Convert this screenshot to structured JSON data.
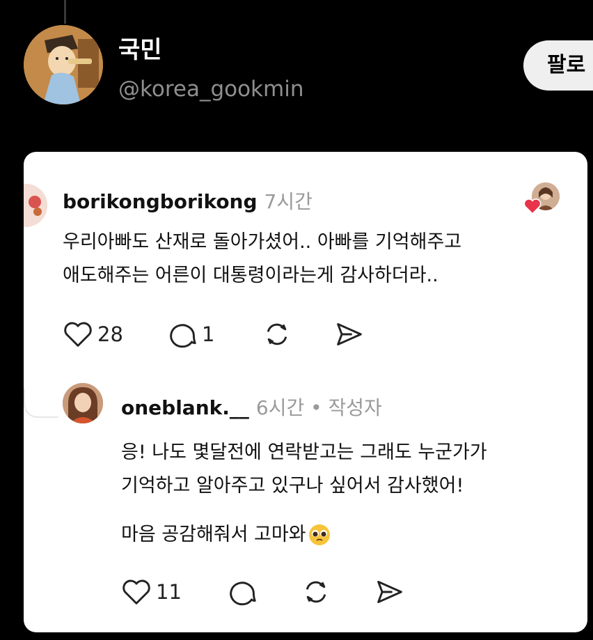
{
  "profile": {
    "name": "국민",
    "handle": "@korea_gookmin",
    "follow_label": "팔로"
  },
  "comment": {
    "username": "borikongborikong",
    "time": "7시간",
    "lines": [
      "우리아빠도 산재로 돌아가셨어.. 아빠를 기억해주고",
      "애도해주는 어른이 대통령이라는게 감사하더라.."
    ],
    "likes": "28",
    "replies": "1"
  },
  "reply": {
    "username": "oneblank.__",
    "meta": "6시간 • 작성자",
    "lines": [
      "응! 나도 몇달전에 연락받고는 그래도 누군가가",
      "기억하고 알아주고 있구나 싶어서 감사했어!"
    ],
    "line3": "마음 공감해줘서 고마와",
    "likes": "11"
  },
  "colors": {
    "background": "#000000",
    "card": "#ffffff",
    "muted": "#9a9a9a",
    "heart": "#e8334a"
  },
  "icons": [
    "heart-icon",
    "comment-icon",
    "repost-icon",
    "send-icon",
    "pleading-face-emoji"
  ]
}
